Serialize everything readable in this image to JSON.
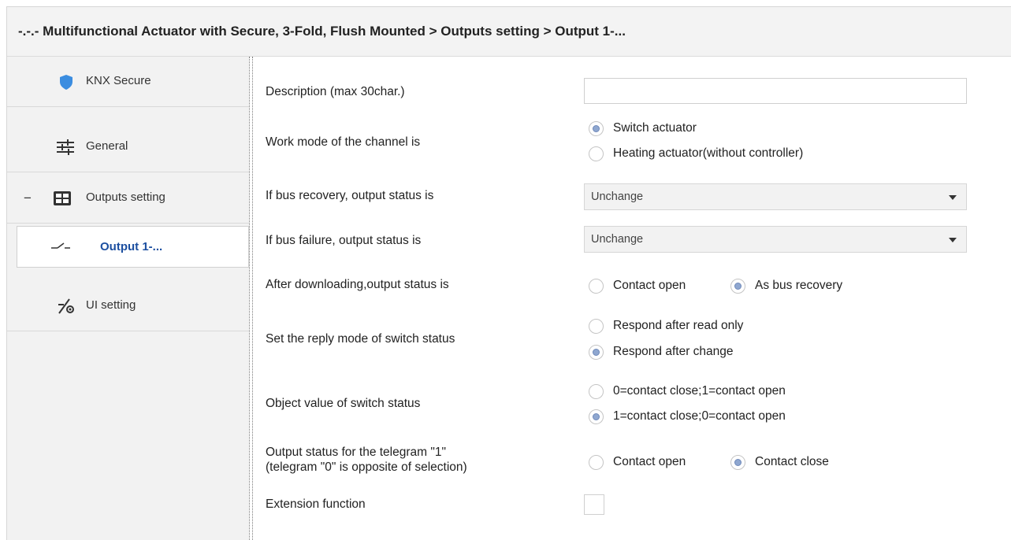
{
  "title": "-.-.- Multifunctional Actuator with Secure, 3-Fold, Flush Mounted > Outputs setting > Output 1-...",
  "sidebar": {
    "items": [
      {
        "label": "KNX Secure",
        "icon": "shield-icon"
      },
      {
        "label": "General",
        "icon": "sliders-icon"
      },
      {
        "label": "Outputs setting",
        "icon": "grid-icon",
        "toggle": "−"
      },
      {
        "label": "Output 1-...",
        "icon": "switch-contact-icon"
      },
      {
        "label": "UI setting",
        "icon": "ui-setting-icon"
      }
    ]
  },
  "params": {
    "description": {
      "label": "Description (max 30char.)",
      "value": ""
    },
    "work_mode": {
      "label": "Work mode of the channel is",
      "options": [
        "Switch actuator",
        "Heating actuator(without controller)"
      ],
      "selected": 0
    },
    "bus_recovery": {
      "label": "If bus recovery, output status is",
      "value": "Unchange"
    },
    "bus_failure": {
      "label": "If bus failure, output status is",
      "value": "Unchange"
    },
    "after_download": {
      "label": "After downloading,output status is",
      "options": [
        "Contact open",
        "As bus recovery"
      ],
      "selected": 1
    },
    "reply_mode": {
      "label": "Set the reply mode of switch status",
      "options": [
        "Respond after read only",
        "Respond after change"
      ],
      "selected": 1
    },
    "object_value": {
      "label": "Object value of switch status",
      "options": [
        "0=contact close;1=contact open",
        "1=contact close;0=contact open"
      ],
      "selected": 1
    },
    "telegram_output": {
      "label_line1": "Output status for the telegram \"1\"",
      "label_line2": " (telegram \"0\" is opposite of selection)",
      "options": [
        "Contact open",
        "Contact close"
      ],
      "selected": 1
    },
    "extension": {
      "label": "Extension function",
      "checked": false
    }
  },
  "colors": {
    "accent": "#1c4fa0",
    "shield": "#3b8de0"
  }
}
